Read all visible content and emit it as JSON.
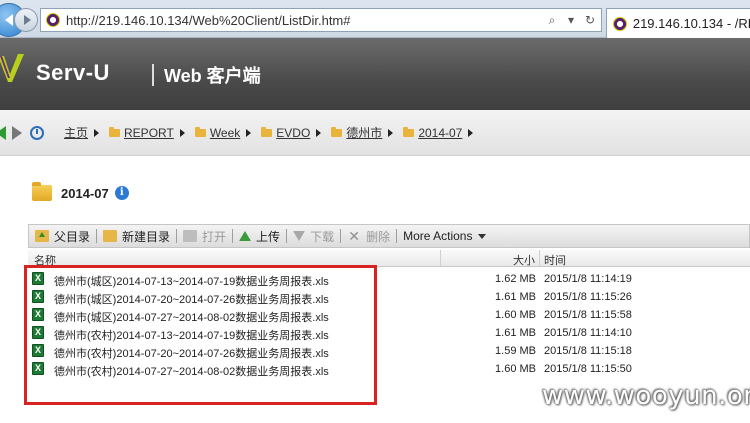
{
  "browser": {
    "url": "http://219.146.10.134/Web%20Client/ListDir.htm#",
    "tab_title": "219.146.10.134 - /RE"
  },
  "app": {
    "logo": "Serv-U",
    "subtitle": "Web 客户端"
  },
  "breadcrumbs": [
    "主页",
    "REPORT",
    "Week",
    "EVDO",
    "德州市",
    "2014-07"
  ],
  "folder": {
    "name": "2014-07"
  },
  "toolbar": {
    "parent_dir": "父目录",
    "new_dir": "新建目录",
    "open": "打开",
    "upload": "上传",
    "download": "下载",
    "delete": "删除",
    "more_actions": "More Actions"
  },
  "columns": {
    "name": "名称",
    "size": "大小",
    "time": "时间"
  },
  "files": [
    {
      "name": "德州市(城区)2014-07-13~2014-07-19数据业务周报表.xls",
      "size": "1.62 MB",
      "time": "2015/1/8 11:14:19"
    },
    {
      "name": "德州市(城区)2014-07-20~2014-07-26数据业务周报表.xls",
      "size": "1.61 MB",
      "time": "2015/1/8 11:15:26"
    },
    {
      "name": "德州市(城区)2014-07-27~2014-08-02数据业务周报表.xls",
      "size": "1.60 MB",
      "time": "2015/1/8 11:15:58"
    },
    {
      "name": "德州市(农村)2014-07-13~2014-07-19数据业务周报表.xls",
      "size": "1.61 MB",
      "time": "2015/1/8 11:14:10"
    },
    {
      "name": "德州市(农村)2014-07-20~2014-07-26数据业务周报表.xls",
      "size": "1.59 MB",
      "time": "2015/1/8 11:15:18"
    },
    {
      "name": "德州市(农村)2014-07-27~2014-08-02数据业务周报表.xls",
      "size": "1.60 MB",
      "time": "2015/1/8 11:15:50"
    }
  ],
  "icons": {
    "file": "excel-icon",
    "folder": "folder-icon",
    "info": "info-icon"
  },
  "colors": {
    "highlight": "#d92323",
    "header_bg": "#4a4a4a"
  },
  "watermark": "www.wooyun.org"
}
